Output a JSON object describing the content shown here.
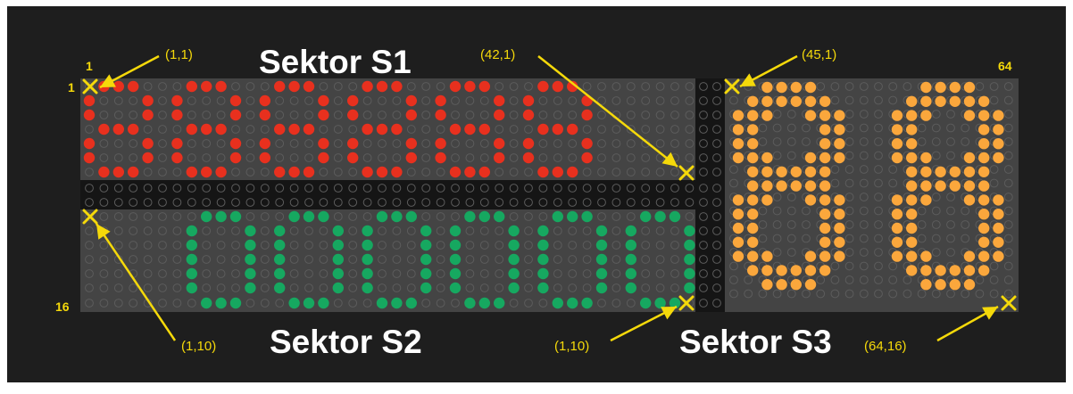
{
  "display": {
    "columns": 64,
    "rows": 16,
    "axis_labels": {
      "col_start": "1",
      "col_end": "64",
      "row_start": "1",
      "row_end": "16"
    },
    "colors": {
      "frame": "#1e1e1e",
      "panel": "#444444",
      "divider": "#151515",
      "led_off_stroke": "#5c5c5c",
      "marker": "#f5d90a",
      "title": "#ffffff"
    }
  },
  "sectors": [
    {
      "id": "s1",
      "title": "Sektor S1",
      "color": "#e8301e",
      "digit_count": 6,
      "digit_value": "8",
      "start_label": "(1,1)",
      "end_label": "(42,1)"
    },
    {
      "id": "s2",
      "title": "Sektor S2",
      "color": "#16a860",
      "digit_count": 6,
      "digit_value": "0",
      "start_label": "(1,10)",
      "end_label": "(1,10)"
    },
    {
      "id": "s3",
      "title": "Sektor S3",
      "color": "#fba73c",
      "digit_count": 2,
      "digit_value": "8",
      "start_label": "(45,1)",
      "end_label": "(64,16)"
    }
  ]
}
